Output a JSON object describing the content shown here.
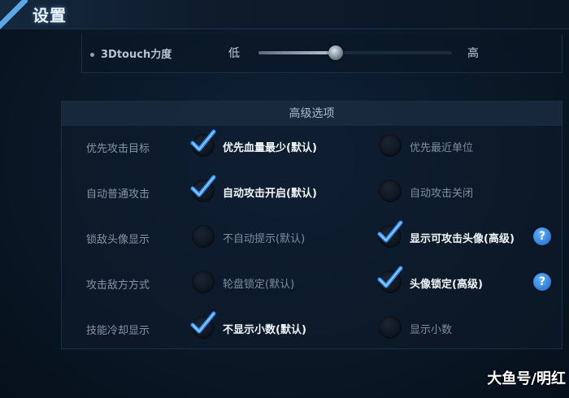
{
  "header": {
    "title": "设置"
  },
  "touch": {
    "label": "3Dtouch力度",
    "low_label": "低",
    "high_label": "高",
    "level": 0.4
  },
  "advanced": {
    "heading": "高级选项",
    "rows": [
      {
        "label": "优先攻击目标",
        "options": [
          {
            "text": "优先血量最少(默认)",
            "selected": true,
            "help": false
          },
          {
            "text": "优先最近单位",
            "selected": false,
            "help": false
          }
        ]
      },
      {
        "label": "自动普通攻击",
        "options": [
          {
            "text": "自动攻击开启(默认)",
            "selected": true,
            "help": false
          },
          {
            "text": "自动攻击关闭",
            "selected": false,
            "help": false
          }
        ]
      },
      {
        "label": "锁敌头像显示",
        "options": [
          {
            "text": "不自动提示(默认)",
            "selected": false,
            "help": false
          },
          {
            "text": "显示可攻击头像(高级)",
            "selected": true,
            "help": true
          }
        ]
      },
      {
        "label": "攻击敌方方式",
        "options": [
          {
            "text": "轮盘锁定(默认)",
            "selected": false,
            "help": false
          },
          {
            "text": "头像锁定(高级)",
            "selected": true,
            "help": true
          }
        ]
      },
      {
        "label": "技能冷却显示",
        "options": [
          {
            "text": "不显示小数(默认)",
            "selected": true,
            "help": false
          },
          {
            "text": "显示小数",
            "selected": false,
            "help": false
          }
        ]
      }
    ],
    "help_symbol": "?"
  },
  "watermark": "大鱼号/明红",
  "colors": {
    "check": "#2e8fff",
    "help": "#2f7fd6"
  }
}
